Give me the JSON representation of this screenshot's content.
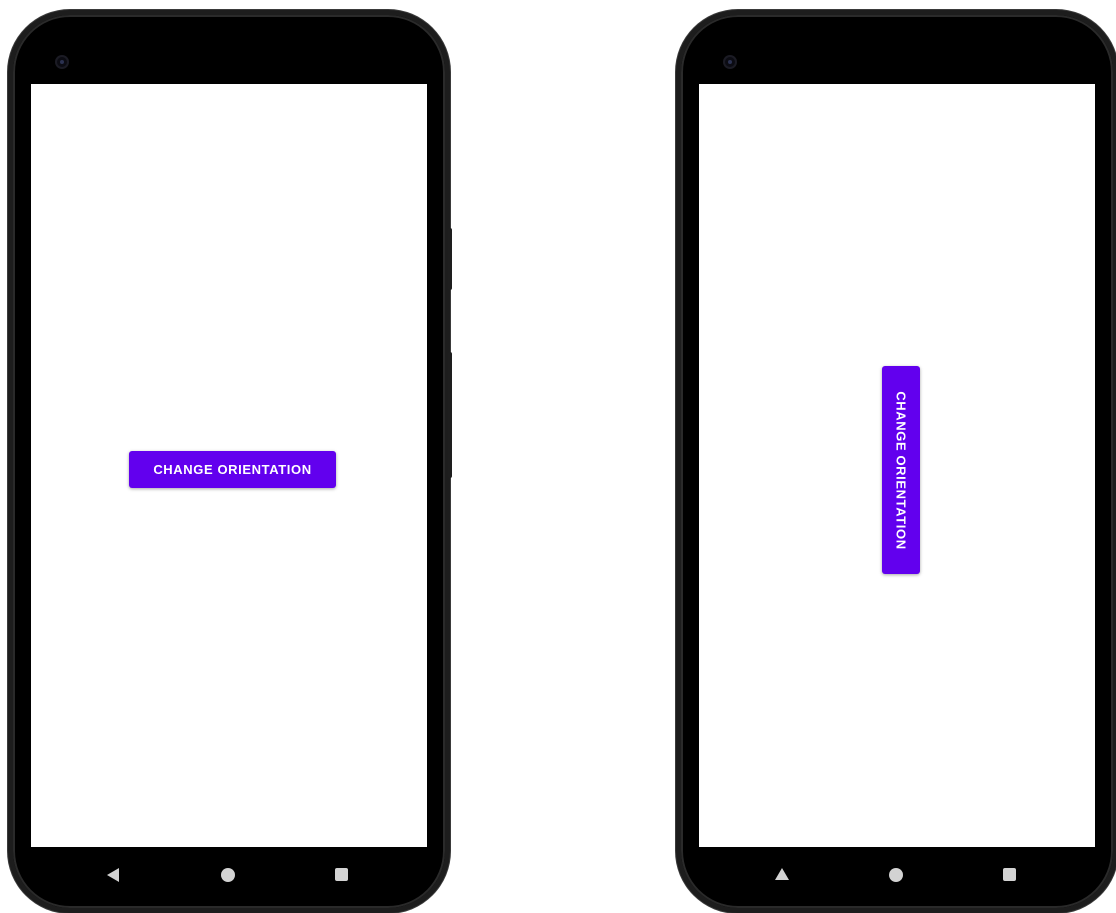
{
  "devices": {
    "portrait": {
      "button_label": "CHANGE ORIENTATION",
      "nav": {
        "back_icon": "back-triangle-icon",
        "home_icon": "home-circle-icon",
        "recents_icon": "recents-square-icon"
      }
    },
    "rotated": {
      "button_label": "CHANGE ORIENTATION",
      "nav": {
        "back_icon": "back-triangle-icon",
        "home_icon": "home-circle-icon",
        "recents_icon": "recents-square-icon"
      }
    }
  },
  "colors": {
    "button_background": "#6200ee",
    "button_text": "#ffffff",
    "screen_background": "#ffffff",
    "device_frame": "#000000",
    "nav_icon": "#d3d3d3"
  }
}
